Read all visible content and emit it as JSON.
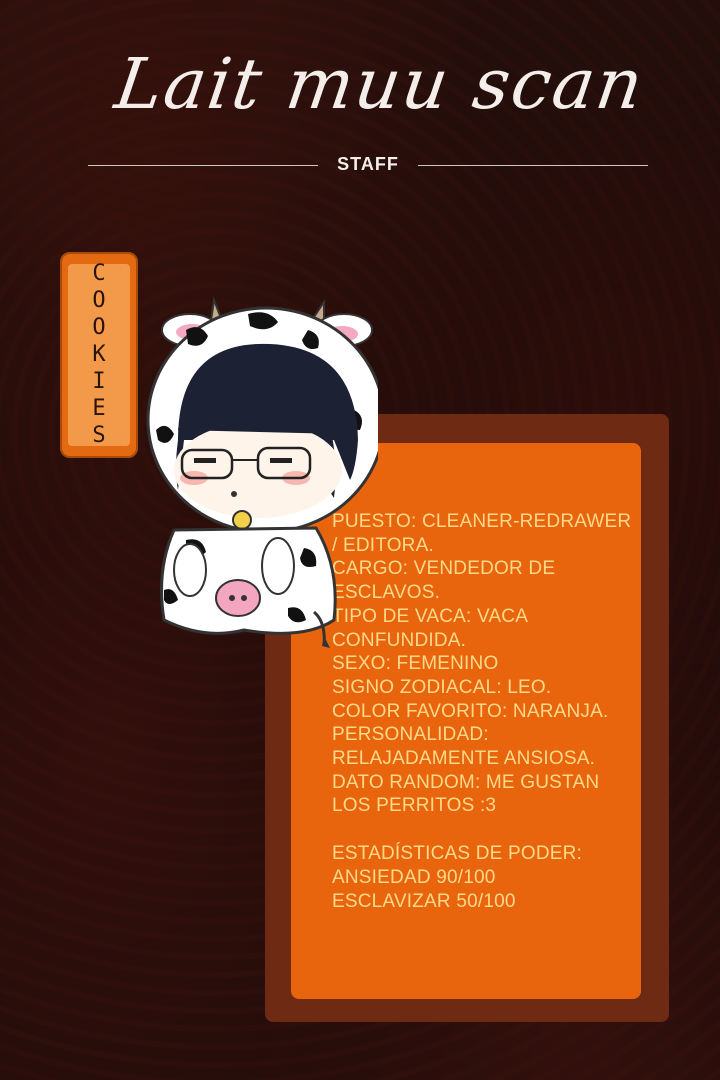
{
  "header": {
    "logo_text": "Lait muu scan",
    "section_label": "STAFF"
  },
  "member": {
    "name": "COOKIES",
    "lines": [
      "PUESTO: CLEANER-REDRAWER / EDITORA.",
      "CARGO: VENDEDOR DE ESCLAVOS.",
      "TIPO DE VACA: VACA CONFUNDIDA.",
      "SEXO: FEMENINO",
      "SIGNO ZODIACAL: LEO.",
      "COLOR FAVORITO: NARANJA.",
      "PERSONALIDAD: RELAJADAMENTE ANSIOSA.",
      "DATO RANDOM: ME GUSTAN LOS PERRITOS :3"
    ],
    "stats_title": "ESTADÍSTICAS DE PODER:",
    "stats": [
      "ANSIEDAD 90/100",
      "ESCLAVIZAR 50/100"
    ]
  },
  "colors": {
    "background": "#1e0c0a",
    "accent_orange": "#e8650e",
    "panel_border": "#6e2a12",
    "info_text": "#ffd98a"
  }
}
